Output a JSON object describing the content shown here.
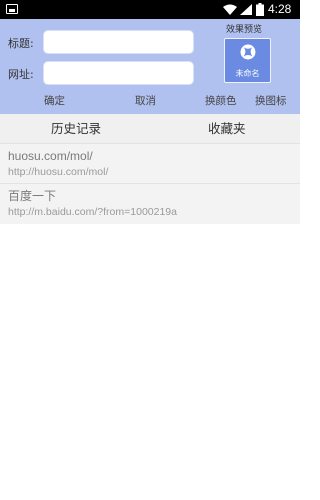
{
  "status_bar": {
    "time": "4:28"
  },
  "form": {
    "title_label": "标题:",
    "title_value": "",
    "url_label": "网址:",
    "url_value": "",
    "confirm_label": "确定",
    "cancel_label": "取消",
    "change_color_label": "换颜色",
    "change_icon_label": "换图标"
  },
  "preview": {
    "title": "效果预览",
    "name": "未命名",
    "icon": "xbox-logo-icon",
    "box_color": "#6a8be1"
  },
  "tabs": [
    {
      "label": "历史记录"
    },
    {
      "label": "收藏夹"
    }
  ],
  "history": [
    {
      "title": "huosu.com/mol/",
      "url": "http://huosu.com/mol/"
    },
    {
      "title": "百度一下",
      "url": "http://m.baidu.com/?from=1000219a"
    }
  ],
  "colors": {
    "header_bg": "#b1c1ef",
    "tab_bg": "#f0f0f0",
    "item_bg": "#f3f3f3"
  }
}
